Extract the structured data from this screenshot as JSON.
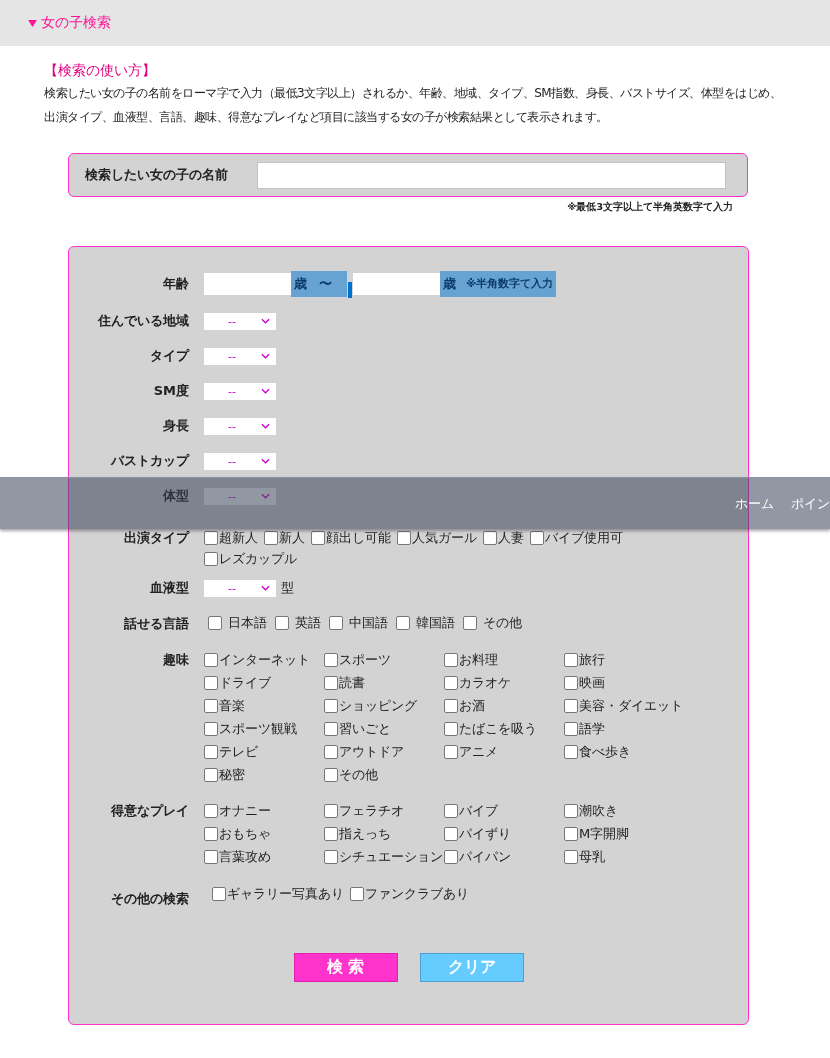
{
  "section_header": {
    "title": "女の子検索"
  },
  "intro": {
    "heading": "【検索の使い方】",
    "text": "検索したい女の子の名前をローマ字で入力（最低3文字以上）されるか、年齢、地域、タイプ、SM指数、身長、バストサイズ、体型をはじめ、出演タイプ、血液型、言語、趣味、得意なプレイなど項目に該当する女の子が検索結果として表示されます。"
  },
  "name_search": {
    "label": "検索したい女の子の名前",
    "note": "※最低3文字以上て半角英数字て入力"
  },
  "form_rows": [
    {
      "kind": "age",
      "label": "年齢",
      "from_unit": "歳",
      "separator": "〜",
      "to_unit": "歳",
      "note": "※半角数字て入力"
    },
    {
      "kind": "select",
      "label": "住んでいる地域",
      "value": "--"
    },
    {
      "kind": "select",
      "label": "タイプ",
      "value": "--"
    },
    {
      "kind": "select",
      "label": "SM度",
      "value": "--"
    },
    {
      "kind": "select",
      "label": "身長",
      "value": "--"
    },
    {
      "kind": "select",
      "label": "バストカップ",
      "value": "--"
    },
    {
      "kind": "select",
      "label": "体型",
      "value": "--"
    },
    {
      "kind": "flow",
      "label": "出演タイプ",
      "options": [
        {
          "label": "超新人",
          "checked": false
        },
        {
          "label": "新人",
          "checked": false
        },
        {
          "label": "顔出し可能",
          "checked": false
        },
        {
          "label": "人気ガール",
          "checked": false
        },
        {
          "label": "人妻",
          "checked": false
        },
        {
          "label": "バイブ使用可",
          "checked": false
        },
        {
          "label": "レズカップル",
          "checked": false
        }
      ]
    },
    {
      "kind": "select",
      "label": "血液型",
      "value": "--",
      "suffix": "型"
    },
    {
      "kind": "inline",
      "label": "話せる言語",
      "options": [
        {
          "label": "日本語",
          "checked": false
        },
        {
          "label": "英語",
          "checked": false
        },
        {
          "label": "中国語",
          "checked": false
        },
        {
          "label": "韓国語",
          "checked": false
        },
        {
          "label": "その他",
          "checked": false
        }
      ]
    },
    {
      "kind": "grid",
      "label": "趣味",
      "options": [
        {
          "label": "インターネット",
          "checked": false
        },
        {
          "label": "スポーツ",
          "checked": false
        },
        {
          "label": "お料理",
          "checked": false
        },
        {
          "label": "旅行",
          "checked": false
        },
        {
          "label": "ドライブ",
          "checked": false
        },
        {
          "label": "読書",
          "checked": false
        },
        {
          "label": "カラオケ",
          "checked": false
        },
        {
          "label": "映画",
          "checked": false
        },
        {
          "label": "音楽",
          "checked": false
        },
        {
          "label": "ショッピング",
          "checked": false
        },
        {
          "label": "お酒",
          "checked": false
        },
        {
          "label": "美容・ダイエット",
          "checked": false
        },
        {
          "label": "スポーツ観戦",
          "checked": false
        },
        {
          "label": "習いごと",
          "checked": false
        },
        {
          "label": "たばこを吸う",
          "checked": false
        },
        {
          "label": "語学",
          "checked": false
        },
        {
          "label": "テレビ",
          "checked": false
        },
        {
          "label": "アウトドア",
          "checked": false
        },
        {
          "label": "アニメ",
          "checked": false
        },
        {
          "label": "食べ歩き",
          "checked": false
        },
        {
          "label": "秘密",
          "checked": false
        },
        {
          "label": "その他",
          "checked": false
        }
      ]
    },
    {
      "kind": "grid",
      "label": "得意なプレイ",
      "options": [
        {
          "label": "オナニー",
          "checked": false
        },
        {
          "label": "フェラチオ",
          "checked": false
        },
        {
          "label": "バイブ",
          "checked": false
        },
        {
          "label": "潮吹き",
          "checked": false
        },
        {
          "label": "おもちゃ",
          "checked": false
        },
        {
          "label": "指えっち",
          "checked": false
        },
        {
          "label": "パイずり",
          "checked": false
        },
        {
          "label": "M字開脚",
          "checked": false
        },
        {
          "label": "言葉攻め",
          "checked": false
        },
        {
          "label": "シチュエーション",
          "checked": false
        },
        {
          "label": "パイパン",
          "checked": false
        },
        {
          "label": "母乳",
          "checked": false
        }
      ]
    },
    {
      "kind": "tight",
      "label": "その他の検索",
      "options": [
        {
          "label": "ギャラリー写真あり",
          "checked": false
        },
        {
          "label": "ファンクラブあり",
          "checked": false
        }
      ]
    }
  ],
  "buttons": [
    {
      "kind": "search",
      "label": "検 索"
    },
    {
      "kind": "clear",
      "label": "クリア"
    }
  ],
  "overlay_nav": {
    "items": [
      "ホーム",
      "ポイン"
    ]
  }
}
